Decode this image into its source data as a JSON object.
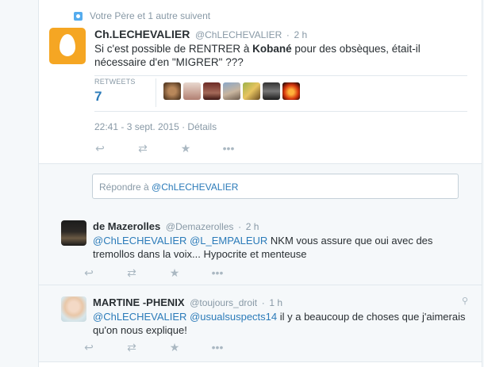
{
  "context": {
    "text": "Votre Père et 1 autre suivent"
  },
  "main_tweet": {
    "fullname": "Ch.LECHEVALIER",
    "handle": "@ChLECHEVALIER",
    "time": "2 h",
    "text_before": "Si c'est possible de RENTRER à ",
    "text_bold": "Kobané",
    "text_after": " pour des obsèques, était-il nécessaire d'en \"MIGRER\" ???",
    "retweets_label": "RETWEETS",
    "retweets_value": "7",
    "timestamp": "22:41 - 3 sept. 2015 · Détails",
    "colors": {
      "avatar_bg": "#f5a623",
      "link": "#2b7bb9"
    }
  },
  "reply_box": {
    "prefix": "Répondre à ",
    "mention": "@ChLECHEVALIER"
  },
  "replies": [
    {
      "fullname": "de Mazerolles",
      "handle": "@Demazerolles",
      "time": "2 h",
      "mention1": "@ChLECHEVALIER",
      "mention2": "@L_EMPALEUR",
      "text": " NKM vous assure que oui avec des tremollos dans la voix... Hypocrite et menteuse"
    },
    {
      "fullname": "MARTINE -PHENIX",
      "handle": "@toujours_droit",
      "time": "1 h",
      "mention1": "@ChLECHEVALIER",
      "mention2": "@usualsuspects14",
      "text": "  il y a beaucoup de choses que j'aimerais qu'on nous explique!"
    }
  ],
  "icons": {
    "reply": "reply-icon",
    "retweet": "retweet-icon",
    "favorite": "star-icon",
    "more": "more-icon",
    "location": "location-pin-icon"
  }
}
